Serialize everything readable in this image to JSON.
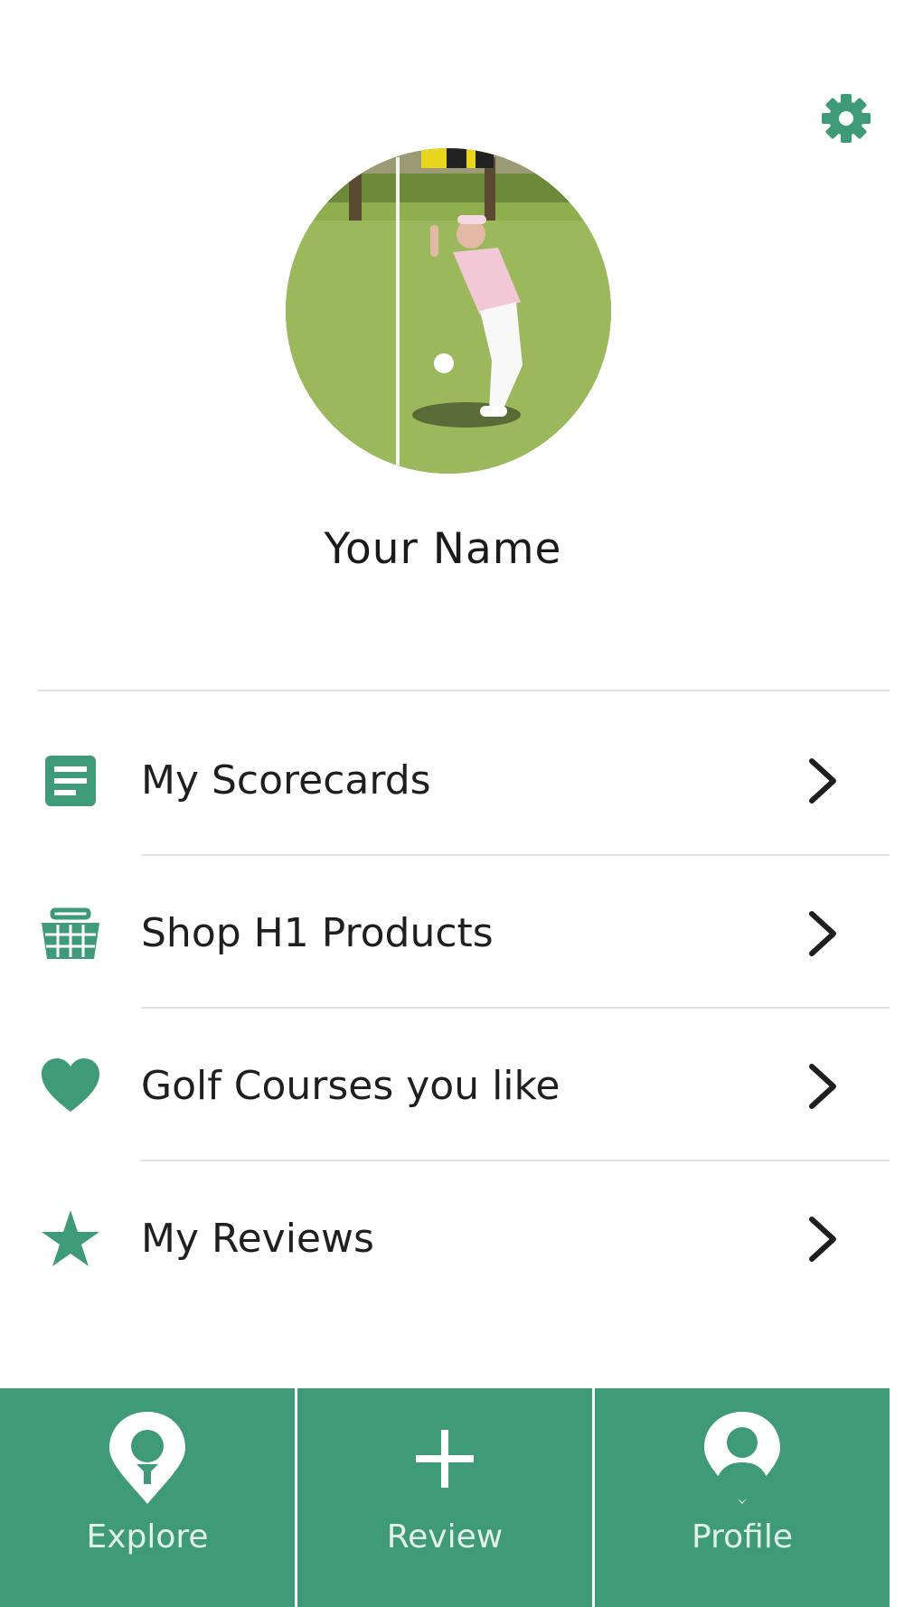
{
  "header": {
    "settings_icon": "gear-icon"
  },
  "profile": {
    "name": "Your Name",
    "avatar": "golfer-photo"
  },
  "menu": {
    "items": [
      {
        "label": "My Scorecards",
        "icon": "scorecard-icon"
      },
      {
        "label": "Shop H1 Products",
        "icon": "basket-icon"
      },
      {
        "label": "Golf Courses you like",
        "icon": "heart-icon"
      },
      {
        "label": "My Reviews",
        "icon": "star-icon"
      }
    ]
  },
  "tabs": [
    {
      "label": "Explore",
      "icon": "golf-pin-icon"
    },
    {
      "label": "Review",
      "icon": "plus-icon"
    },
    {
      "label": "Profile",
      "icon": "user-pin-icon"
    }
  ],
  "colors": {
    "accent": "#3f9a78",
    "text": "#1f1f1f",
    "divider": "#e2e2e2"
  }
}
